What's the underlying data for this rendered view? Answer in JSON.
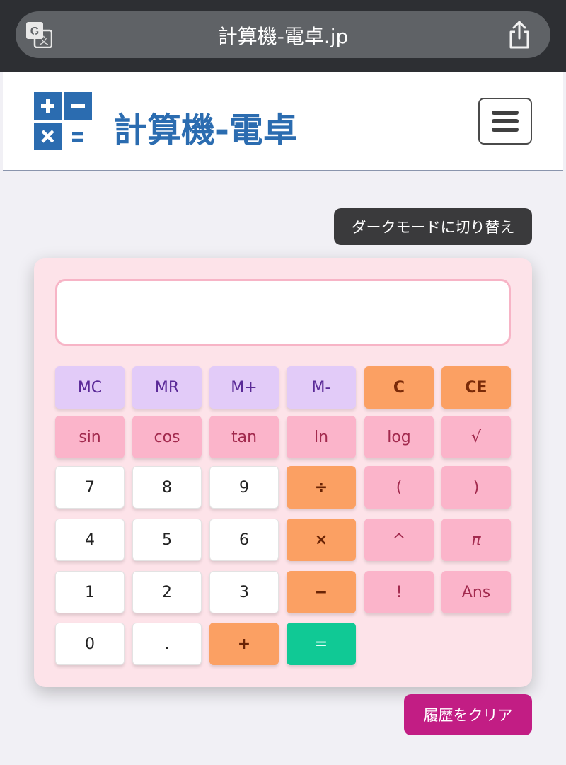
{
  "browser": {
    "url": "計算機-電卓.jp",
    "translate_icon": "translate-icon",
    "share_icon": "share-icon"
  },
  "header": {
    "title": "計算機-電卓",
    "logo_icon": "calculator-logo-icon",
    "menu_icon": "hamburger-menu-icon"
  },
  "dark_mode_label": "ダークモードに切り替え",
  "calculator": {
    "display_value": "",
    "rows": [
      [
        {
          "label": "MC",
          "kind": "mem"
        },
        {
          "label": "MR",
          "kind": "mem"
        },
        {
          "label": "M+",
          "kind": "mem"
        },
        {
          "label": "M-",
          "kind": "mem"
        },
        {
          "label": "C",
          "kind": "clear"
        },
        {
          "label": "CE",
          "kind": "clear"
        }
      ],
      [
        {
          "label": "sin",
          "kind": "fn"
        },
        {
          "label": "cos",
          "kind": "fn"
        },
        {
          "label": "tan",
          "kind": "fn"
        },
        {
          "label": "ln",
          "kind": "fn"
        },
        {
          "label": "log",
          "kind": "fn"
        },
        {
          "label": "√",
          "kind": "fn"
        }
      ],
      [
        {
          "label": "7",
          "kind": "num"
        },
        {
          "label": "8",
          "kind": "num"
        },
        {
          "label": "9",
          "kind": "num"
        },
        {
          "label": "÷",
          "kind": "op"
        },
        {
          "label": "(",
          "kind": "fn"
        },
        {
          "label": ")",
          "kind": "fn"
        }
      ],
      [
        {
          "label": "4",
          "kind": "num"
        },
        {
          "label": "5",
          "kind": "num"
        },
        {
          "label": "6",
          "kind": "num"
        },
        {
          "label": "×",
          "kind": "op"
        },
        {
          "label": "^",
          "kind": "fn"
        },
        {
          "label": "π",
          "kind": "fn"
        }
      ],
      [
        {
          "label": "1",
          "kind": "num"
        },
        {
          "label": "2",
          "kind": "num"
        },
        {
          "label": "3",
          "kind": "num"
        },
        {
          "label": "−",
          "kind": "op"
        },
        {
          "label": "!",
          "kind": "fn"
        },
        {
          "label": "Ans",
          "kind": "fn"
        }
      ],
      [
        {
          "label": "0",
          "kind": "num"
        },
        {
          "label": ".",
          "kind": "num"
        },
        {
          "label": "+",
          "kind": "op"
        },
        {
          "label": "=",
          "kind": "eq"
        }
      ]
    ]
  },
  "clear_history_label": "履歴をクリア",
  "colors": {
    "brand_blue": "#2b6cb0",
    "memory_key": "#e2cbf8",
    "clear_key": "#fba063",
    "function_key": "#fbb4ca",
    "equals_key": "#10c995",
    "clear_history_button": "#c21d84"
  }
}
